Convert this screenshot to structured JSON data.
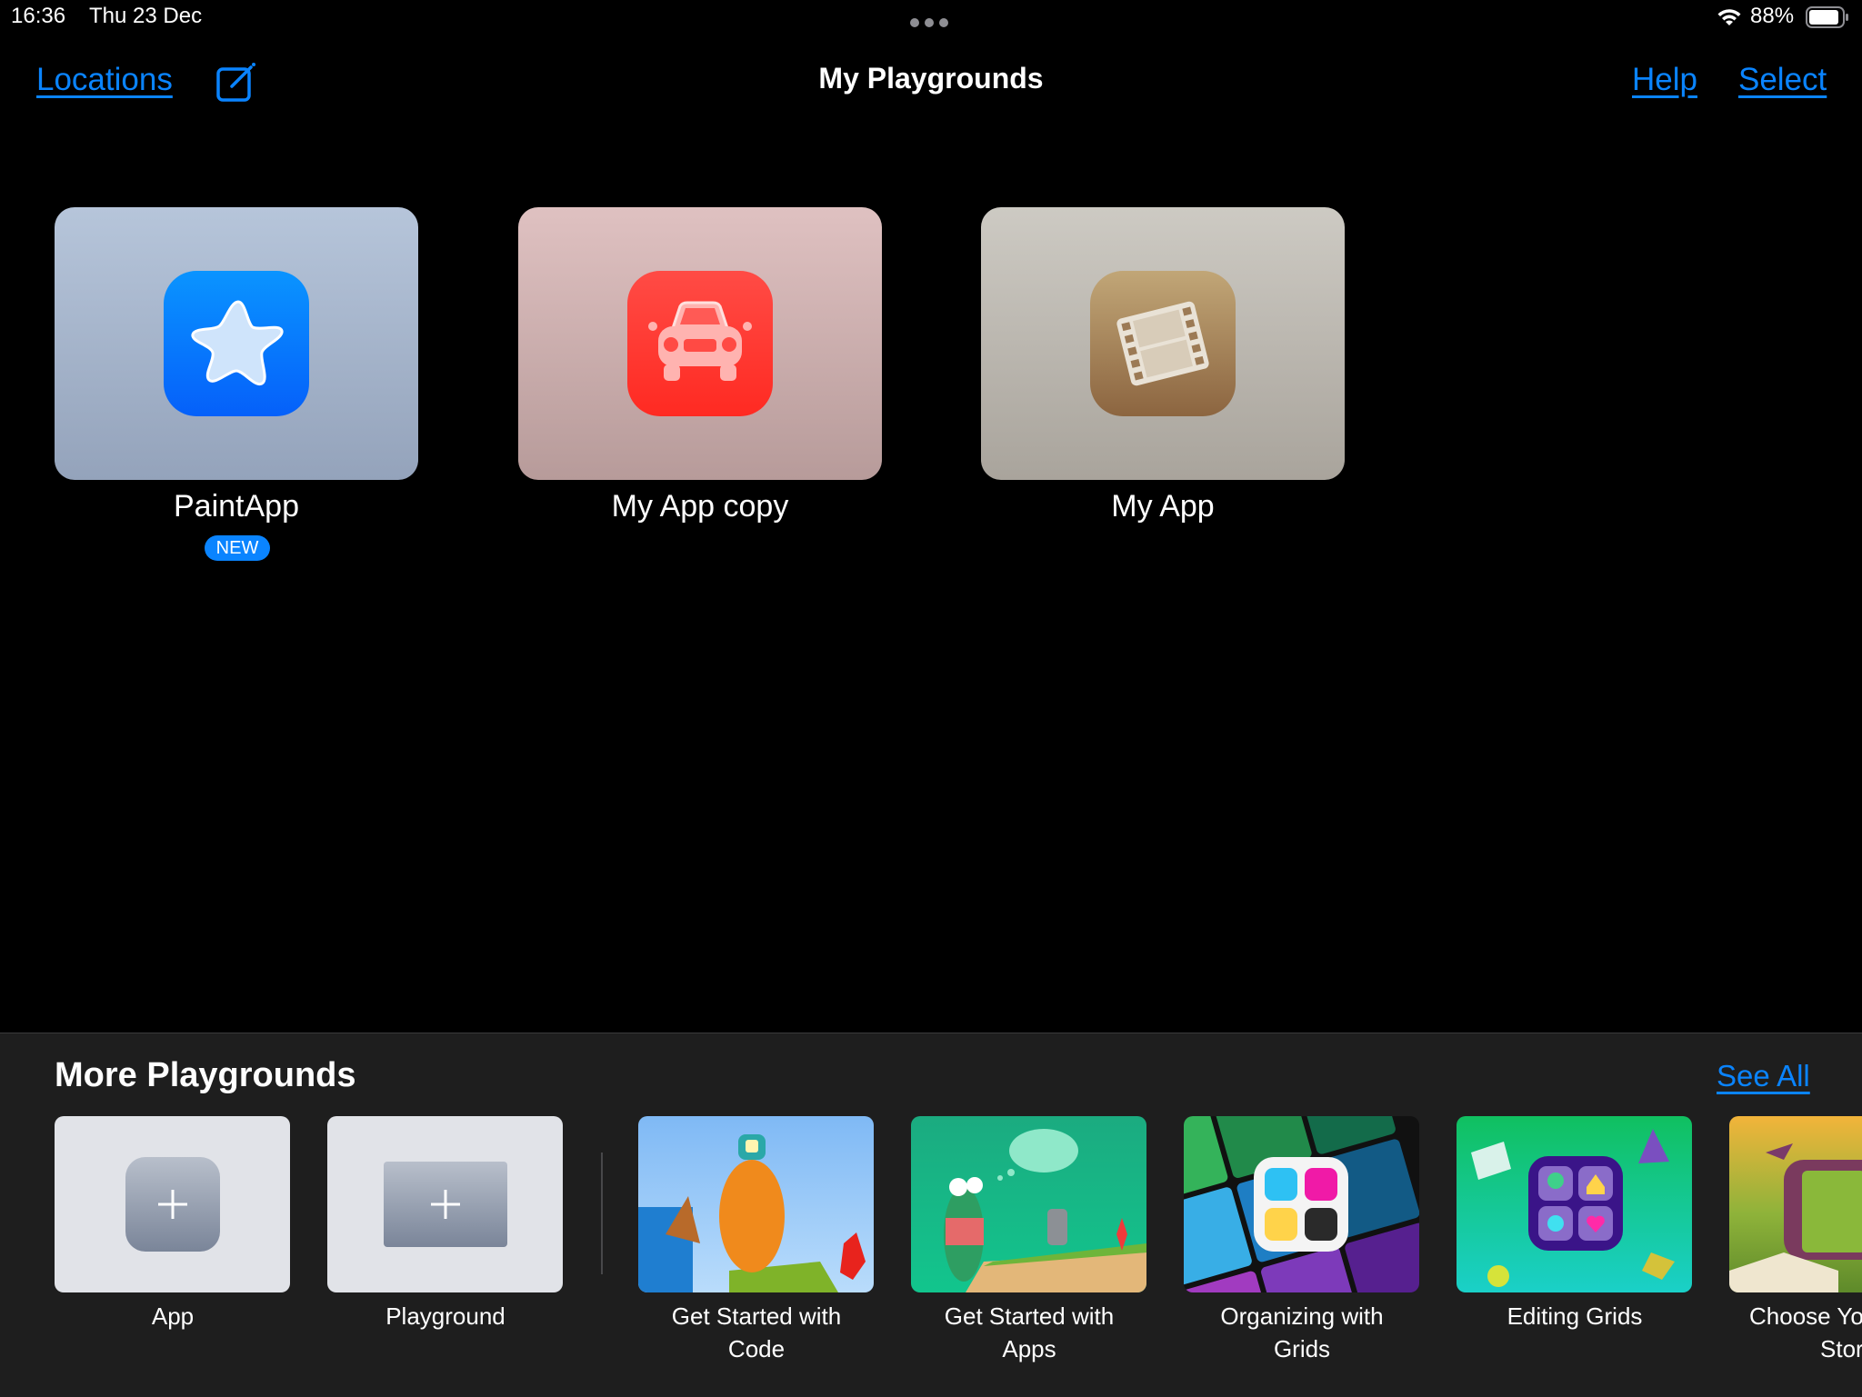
{
  "status_bar": {
    "time": "16:36",
    "date": "Thu 23 Dec",
    "battery": "88%",
    "battery_level": 0.88
  },
  "nav": {
    "title": "My Playgrounds",
    "locations": "Locations",
    "help": "Help",
    "select": "Select"
  },
  "playgrounds": [
    {
      "name": "PaintApp",
      "badge": "NEW",
      "icon": "star-icon"
    },
    {
      "name": "My App copy",
      "icon": "car-icon"
    },
    {
      "name": "My App",
      "icon": "film-strip-icon"
    }
  ],
  "more": {
    "title": "More Playgrounds",
    "see_all": "See All",
    "templates": [
      {
        "label": "App"
      },
      {
        "label": "Playground"
      }
    ],
    "items": [
      {
        "line1": "Get Started with",
        "line2": "Code"
      },
      {
        "line1": "Get Started with",
        "line2": "Apps"
      },
      {
        "line1": "Organizing with",
        "line2": "Grids"
      },
      {
        "line1": "Editing Grids",
        "line2": ""
      },
      {
        "line1": "Choose Yo",
        "line2": "Stor"
      }
    ]
  },
  "colors": {
    "accent": "#0a84ff",
    "panel": "#1e1e1e"
  }
}
